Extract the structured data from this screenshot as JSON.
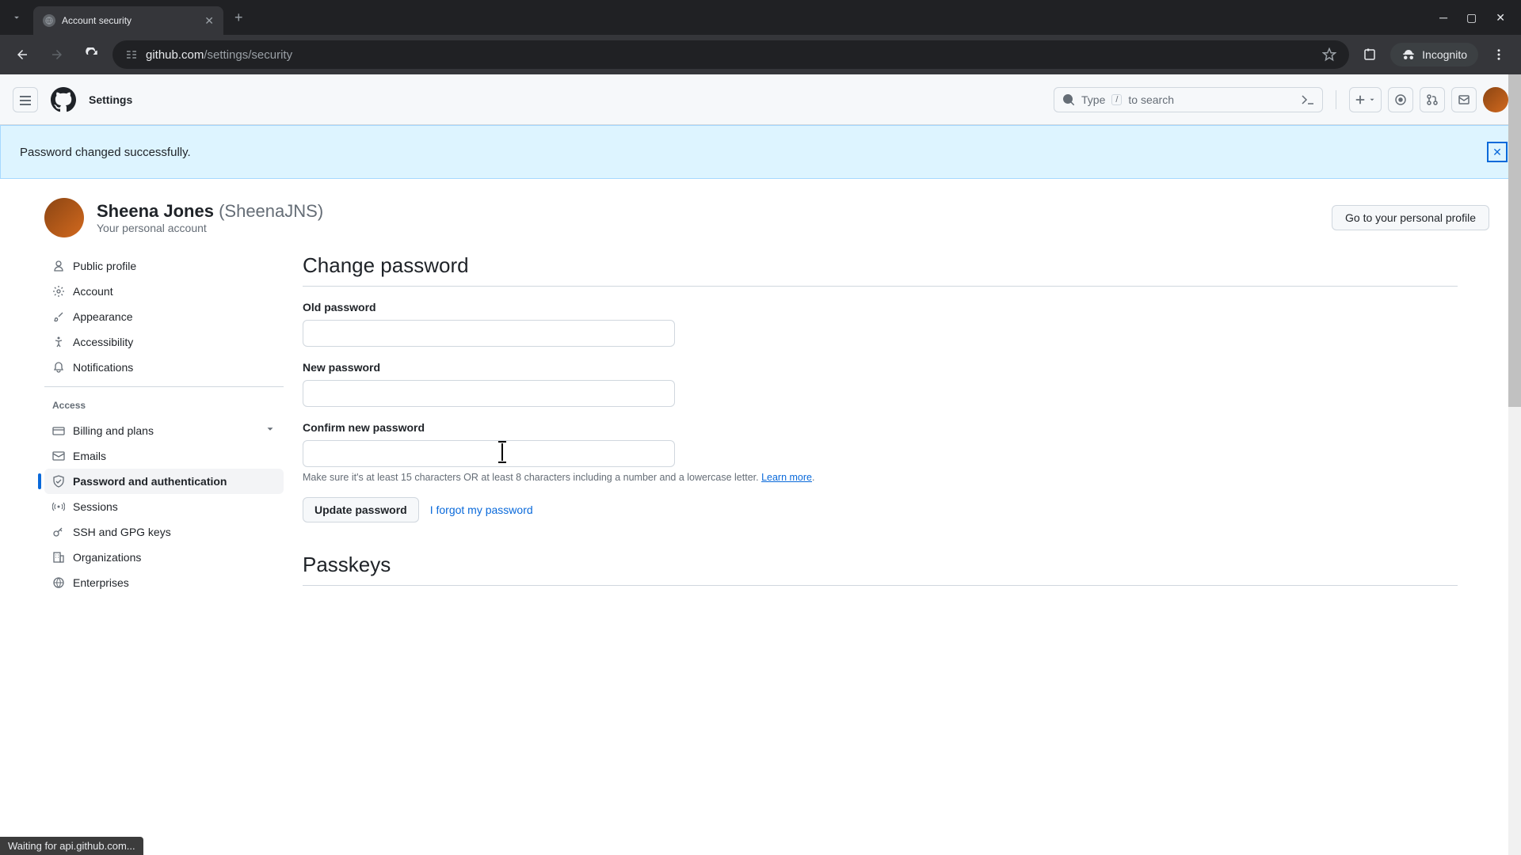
{
  "browser": {
    "tab_title": "Account security",
    "url_domain": "github.com",
    "url_path": "/settings/security",
    "incognito_label": "Incognito",
    "status_text": "Waiting for api.github.com..."
  },
  "header": {
    "title": "Settings",
    "search_placeholder_pre": "Type ",
    "search_kbd": "/",
    "search_placeholder_post": " to search"
  },
  "flash": {
    "message": "Password changed successfully."
  },
  "profile": {
    "display_name": "Sheena Jones",
    "handle": "(SheenaJNS)",
    "subtitle": "Your personal account",
    "cta": "Go to your personal profile"
  },
  "sidebar": {
    "items_a": [
      {
        "label": "Public profile",
        "icon": "person"
      },
      {
        "label": "Account",
        "icon": "gear"
      },
      {
        "label": "Appearance",
        "icon": "brush"
      },
      {
        "label": "Accessibility",
        "icon": "accessibility"
      },
      {
        "label": "Notifications",
        "icon": "bell"
      }
    ],
    "section_access": "Access",
    "items_b": [
      {
        "label": "Billing and plans",
        "icon": "card",
        "expandable": true
      },
      {
        "label": "Emails",
        "icon": "mail"
      },
      {
        "label": "Password and authentication",
        "icon": "shield",
        "active": true
      },
      {
        "label": "Sessions",
        "icon": "broadcast"
      },
      {
        "label": "SSH and GPG keys",
        "icon": "key"
      },
      {
        "label": "Organizations",
        "icon": "org"
      },
      {
        "label": "Enterprises",
        "icon": "globe"
      }
    ]
  },
  "main": {
    "change_password_heading": "Change password",
    "old_password_label": "Old password",
    "new_password_label": "New password",
    "confirm_password_label": "Confirm new password",
    "hint_text": "Make sure it's at least 15 characters OR at least 8 characters including a number and a lowercase letter. ",
    "hint_link": "Learn more",
    "hint_suffix": ".",
    "update_button": "Update password",
    "forgot_link": "I forgot my password",
    "passkeys_heading": "Passkeys"
  }
}
